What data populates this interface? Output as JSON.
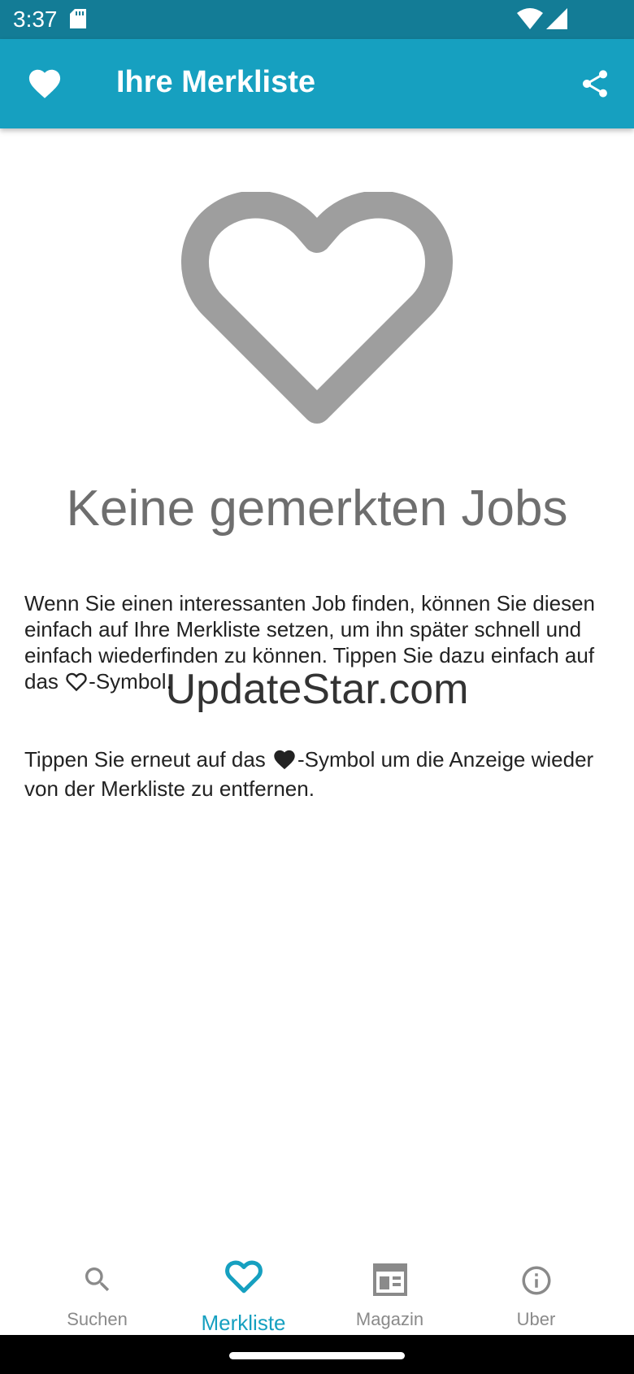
{
  "status": {
    "time": "3:37"
  },
  "appbar": {
    "title": "Ihre Merkliste"
  },
  "empty_state": {
    "title": "Keine gemerkten Jobs",
    "p1_before": "Wenn Sie einen interessanten Job finden, können Sie diesen einfach auf Ihre Merkliste setzen, um ihn später schnell und einfach wiederfinden zu können. Tippen Sie dazu einfach auf das ",
    "p1_after": "-Symbol.",
    "p2_before": "Tippen Sie erneut auf das ",
    "p2_after": "-Symbol um die Anzeige wieder von der Merkliste zu entfernen."
  },
  "watermark": "UpdateStar.com",
  "nav": [
    {
      "label": "Suchen"
    },
    {
      "label": "Merkliste"
    },
    {
      "label": "Magazin"
    },
    {
      "label": "Uber"
    }
  ],
  "colors": {
    "primary": "#16a0c0",
    "statusbar": "#137c96",
    "icon_gray": "#9e9e9e"
  }
}
